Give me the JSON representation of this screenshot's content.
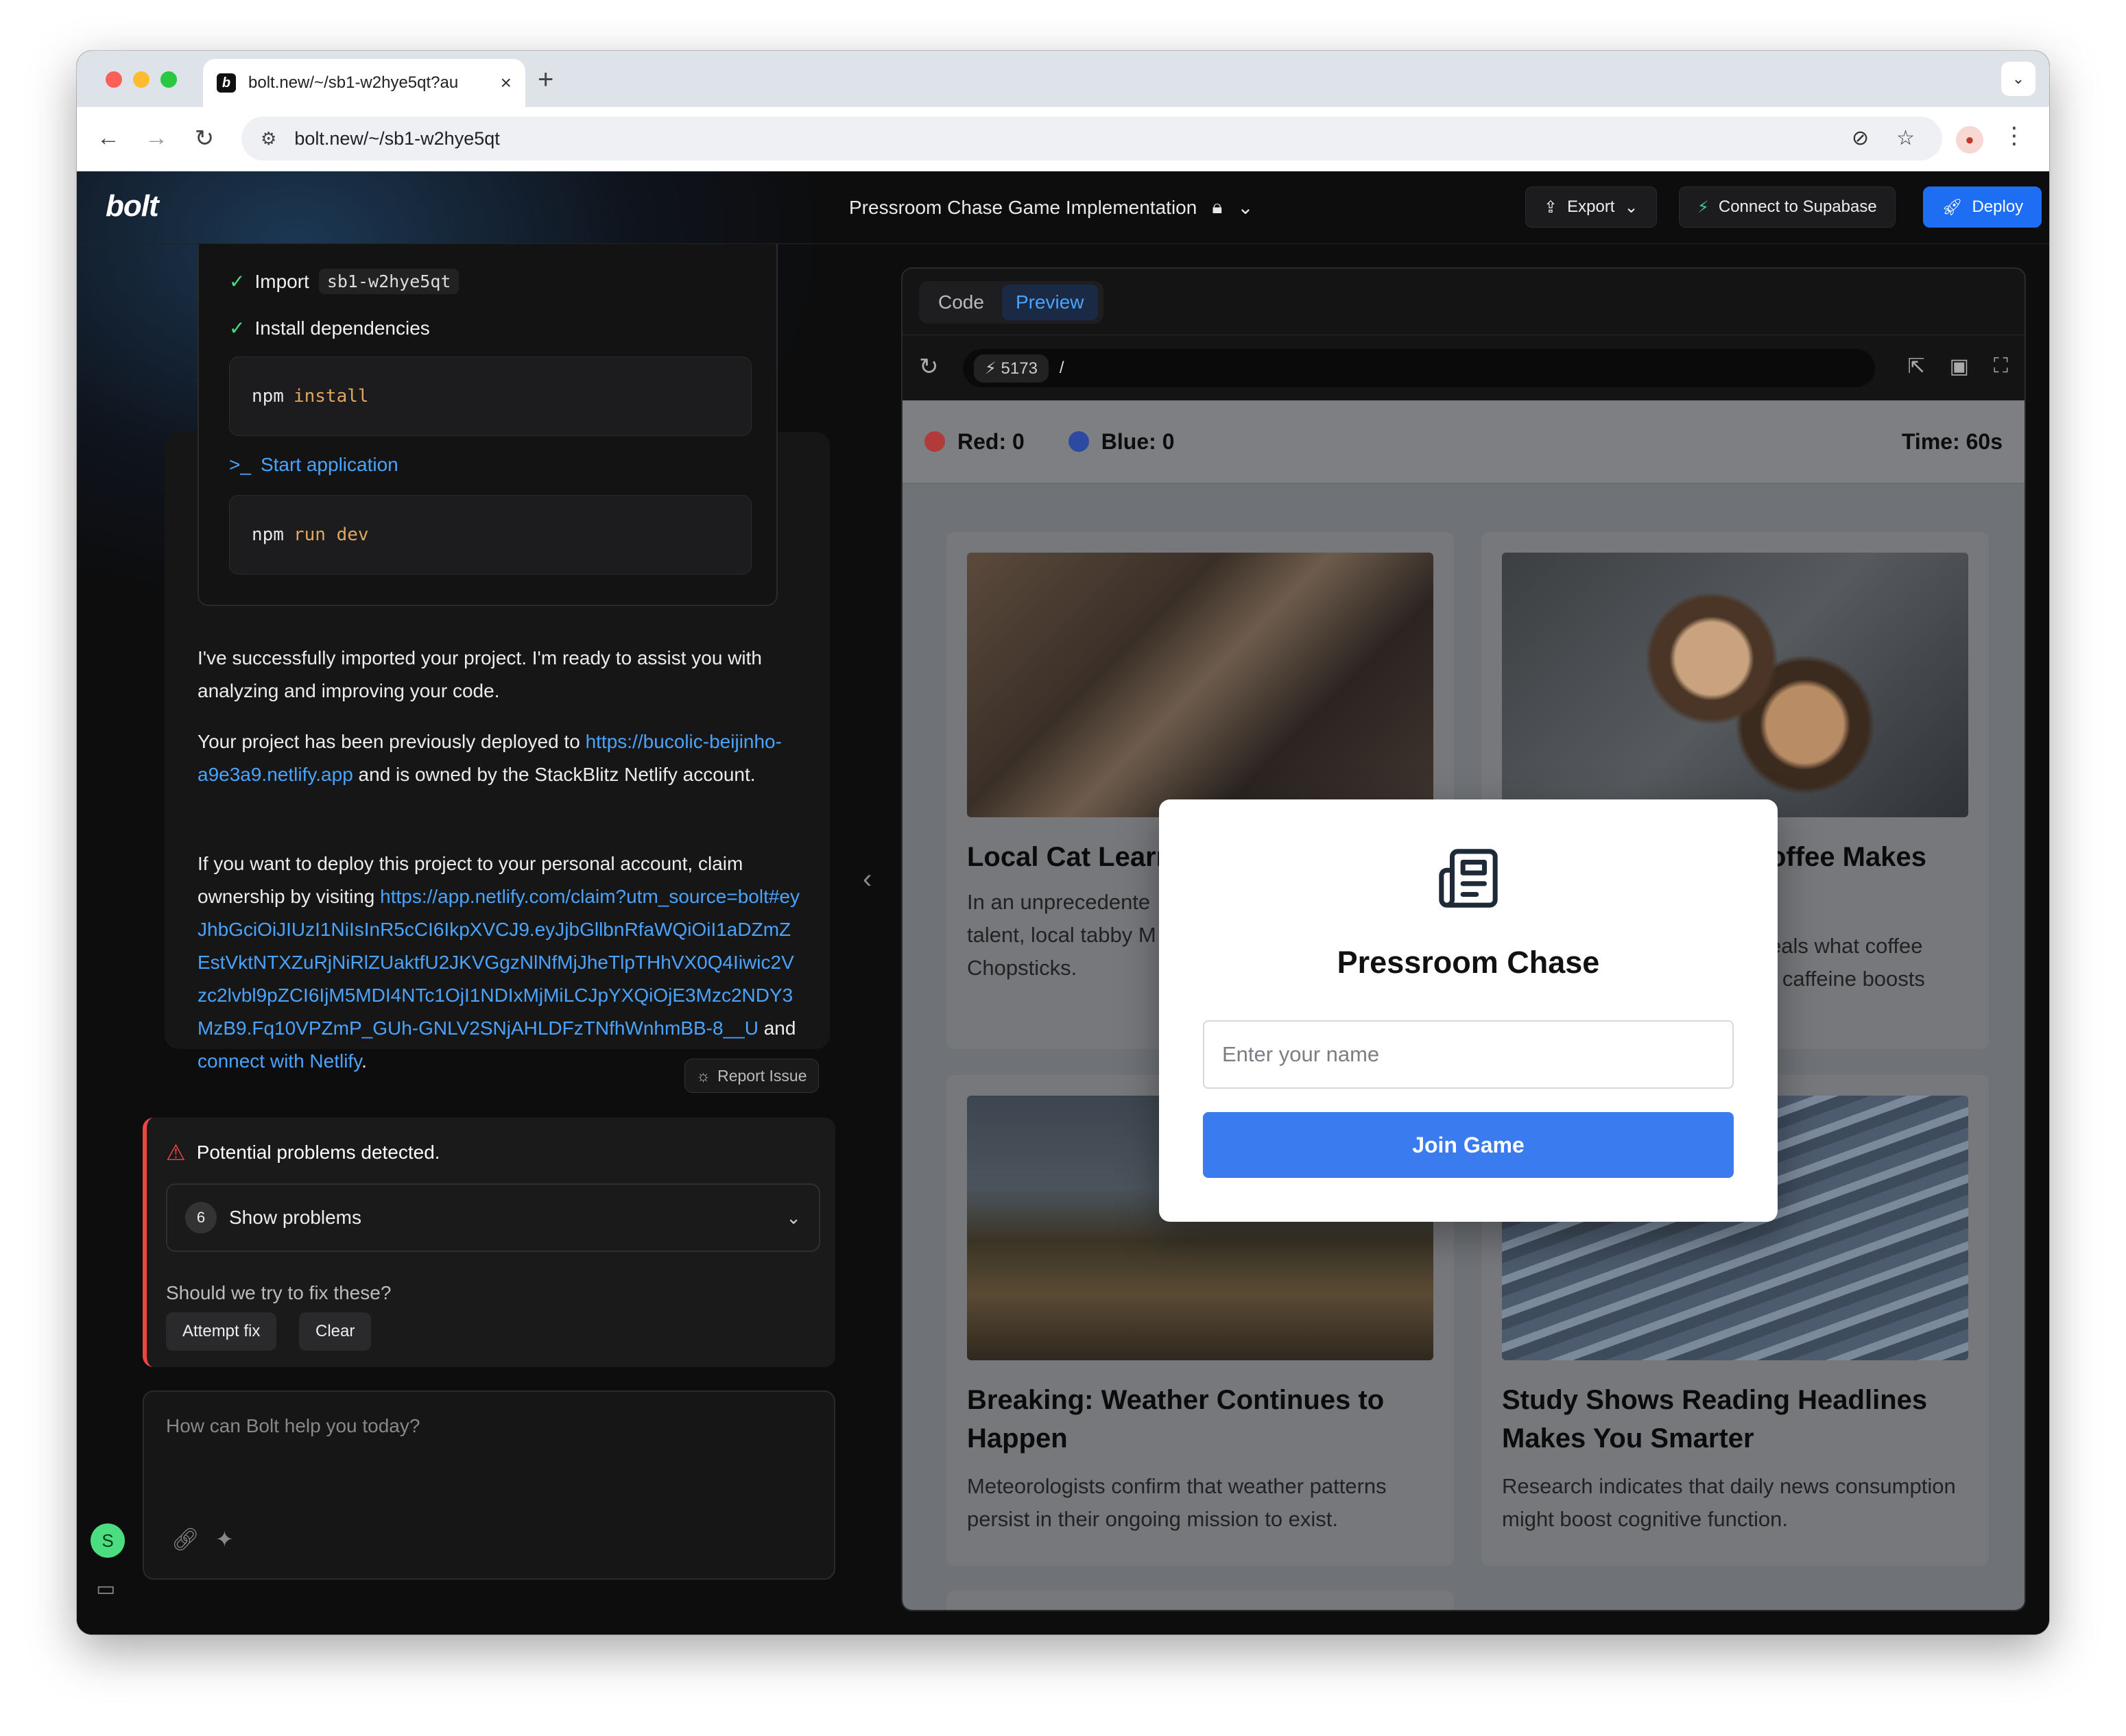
{
  "browser": {
    "tab_title": "bolt.new/~/sb1-w2hye5qt?au",
    "favicon": "b",
    "url": "bolt.new/~/sb1-w2hye5qt"
  },
  "header": {
    "logo": "bolt",
    "project_title": "Pressroom Chase Game Implementation",
    "export_label": "Export",
    "supabase_label": "Connect to Supabase",
    "deploy_label": "Deploy"
  },
  "steps": {
    "import_label": "Import",
    "import_id": "sb1-w2hye5qt",
    "install_label": "Install dependencies",
    "install_cmd": "npm",
    "install_arg": "install",
    "start_label": "Start application",
    "start_cmd": "npm",
    "start_arg": "run dev"
  },
  "chat": {
    "msg1": "I've successfully imported your project. I'm ready to assist you with analyzing and improving your code.",
    "msg2_pre": "Your project has been previously deployed to ",
    "msg2_link": "https://bucolic-beijinho-a9e3a9.netlify.app",
    "msg2_post": " and is owned by the StackBlitz Netlify account.",
    "msg3_pre": "If you want to deploy this project to your personal account, claim ownership by visiting ",
    "msg3_link": "https://app.netlify.com/claim?utm_source=bolt#eyJhbGciOiJIUzI1NiIsInR5cCI6IkpXVCJ9.eyJjbGllbnRfaWQiOiI1aDZmZEstVktNTXZuRjNiRlZUaktfU2JKVGgzNlNfMjJheTlpTHhVX0Q4Iiwic2Vzc2lvbl9pZCI6IjM5MDI4NTc1OjI1NDIxMjMiLCJpYXQiOjE3Mzc2NDY3MzB9.Fq10VPZmP_GUh-GNLV2SNjAHLDFzTNfhWnhmBB-8__U",
    "msg3_mid": " and ",
    "msg3_link2": "connect with Netlify",
    "msg3_end": ".",
    "report_label": "Report Issue"
  },
  "problems": {
    "title": "Potential problems detected.",
    "count": "6",
    "show_label": "Show problems",
    "question": "Should we try to fix these?",
    "attempt_label": "Attempt fix",
    "clear_label": "Clear"
  },
  "prompt": {
    "placeholder": "How can Bolt help you today?"
  },
  "user": {
    "initial": "S"
  },
  "preview": {
    "code_tab": "Code",
    "preview_tab": "Preview",
    "port": "5173",
    "path": "/"
  },
  "game": {
    "red_label": "Red: 0",
    "blue_label": "Blue: 0",
    "time_label": "Time: 60s",
    "colors": {
      "red": "#b13a3a",
      "blue": "#2c4aa0",
      "accent": "#3b7bf0"
    },
    "cards": [
      {
        "title": "Local Cat Learn",
        "body": "In an unprecedente\ntalent, local tabby M\nChopsticks."
      },
      {
        "title": "offee Makes",
        "body": "eals what coffee\n- caffeine boosts"
      },
      {
        "title": "Breaking: Weather Continues to Happen",
        "body": "Meteorologists confirm that weather patterns persist in their ongoing mission to exist."
      },
      {
        "title": "Study Shows Reading Headlines Makes You Smarter",
        "body": "Research indicates that daily news consumption might boost cognitive function."
      }
    ],
    "modal": {
      "title": "Pressroom Chase",
      "placeholder": "Enter your name",
      "button": "Join Game"
    }
  }
}
